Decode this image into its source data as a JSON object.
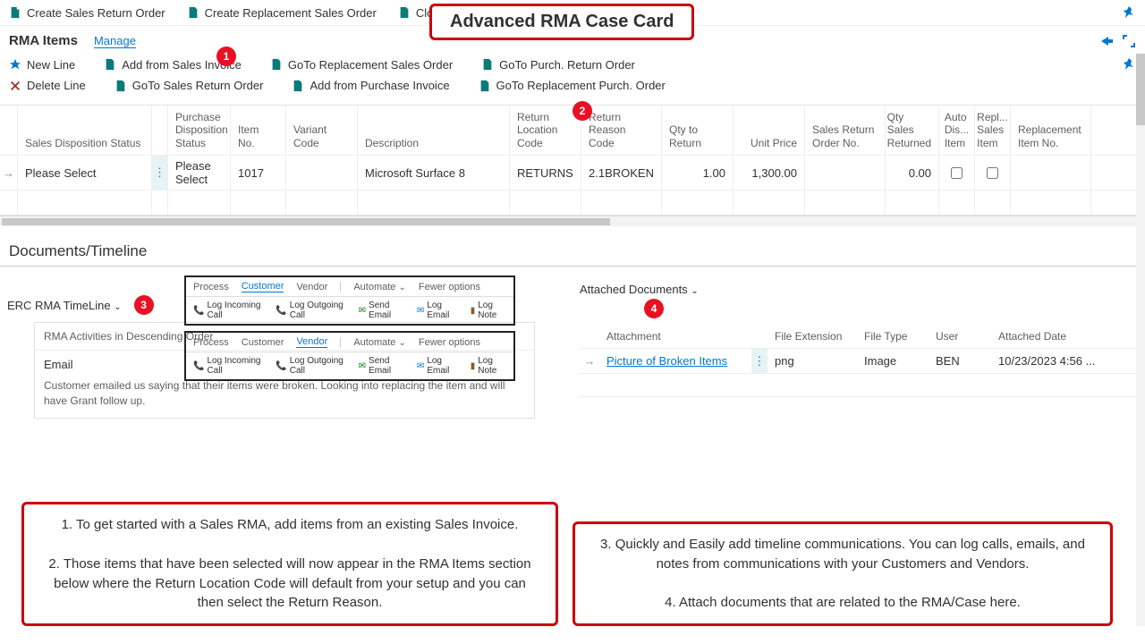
{
  "callout_title": "Advanced RMA Case Card",
  "top_actions": {
    "create_sales_return": "Create Sales Return Order",
    "create_replacement": "Create Replacement Sales Order",
    "close_rma": "Close RMA"
  },
  "rma_items": {
    "title": "RMA Items",
    "manage_label": "Manage",
    "row1": {
      "new_line": "New Line",
      "add_from_sales_invoice": "Add from Sales Invoice",
      "goto_replacement_sales": "GoTo Replacement Sales Order",
      "goto_purch_return": "GoTo Purch. Return Order"
    },
    "row2": {
      "delete_line": "Delete Line",
      "goto_sales_return": "GoTo Sales Return Order",
      "add_from_purchase_invoice": "Add from Purchase Invoice",
      "goto_replacement_purch": "GoTo Replacement Purch. Order"
    },
    "cols": {
      "sales_disp": "Sales Disposition Status",
      "purch_disp": "Purchase Disposition Status",
      "item_no": "Item No.",
      "variant": "Variant Code",
      "description": "Description",
      "return_loc": "Return Location Code",
      "return_reason": "Return Reason Code",
      "qty_return": "Qty to Return",
      "unit_price": "Unit Price",
      "sales_return_no": "Sales Return Order No.",
      "qty_sales_returned": "Qty Sales Returned",
      "auto_dis_item": "Auto Dis... Item",
      "repl_sales_item": "Repl... Sales Item",
      "replacement_item_no": "Replacement Item No."
    },
    "row_data": {
      "sales_disp": "Please Select",
      "purch_disp": "Please Select",
      "item_no": "1017",
      "variant": "",
      "description": "Microsoft Surface 8",
      "return_loc": "RETURNS",
      "return_reason": "2.1BROKEN",
      "qty_return": "1.00",
      "unit_price": "1,300.00",
      "sales_return_no": "",
      "qty_sales_returned": "0.00"
    }
  },
  "documents": {
    "title": "Documents/Timeline",
    "timeline_label": "ERC RMA TimeLine",
    "attached_label": "Attached Documents",
    "mini": {
      "process": "Process",
      "customer": "Customer",
      "vendor": "Vendor",
      "automate": "Automate",
      "fewer": "Fewer options",
      "log_incoming": "Log Incoming Call",
      "log_outgoing": "Log Outgoing Call",
      "send_email": "Send Email",
      "log_email": "Log Email",
      "log_note": "Log Note"
    },
    "activity": {
      "header": "RMA Activities in Descending Order",
      "type": "Email",
      "body": "Customer emailed us saying that their items were broken. Looking into replacing the item and will have Grant follow up."
    },
    "attach_cols": {
      "attachment": "Attachment",
      "ext": "File Extension",
      "type": "File Type",
      "user": "User",
      "date": "Attached Date"
    },
    "attach_row": {
      "name": "Picture of Broken Items",
      "ext": "png",
      "type": "Image",
      "user": "BEN",
      "date": "10/23/2023 4:56 ..."
    }
  },
  "notes": {
    "n1": "1. To get started with a Sales RMA, add items from an existing Sales Invoice.",
    "n2": "2. Those items that have been selected will now appear in the RMA Items section below where the Return Location Code will default from your setup and you can then select the Return Reason.",
    "n3": "3. Quickly and Easily add timeline communications. You can log calls, emails, and notes from communications with your Customers and Vendors.",
    "n4": "4. Attach documents that are related to the RMA/Case here."
  },
  "badges": {
    "b1": "1",
    "b2": "2",
    "b3": "3",
    "b4": "4"
  }
}
